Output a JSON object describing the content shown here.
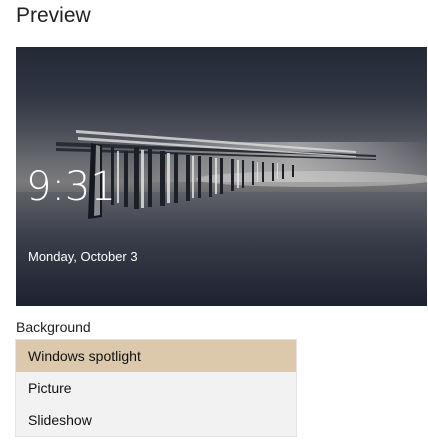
{
  "section": {
    "title": "Preview"
  },
  "preview": {
    "time": "9:31",
    "date": "Monday, October 3"
  },
  "background": {
    "label": "Background",
    "options": [
      {
        "label": "Windows spotlight",
        "selected": true
      },
      {
        "label": "Picture",
        "selected": false
      },
      {
        "label": "Slideshow",
        "selected": false
      }
    ]
  },
  "colors": {
    "selected_option": "#dcc9ab",
    "dropdown_bg": "#f2f2f2"
  }
}
